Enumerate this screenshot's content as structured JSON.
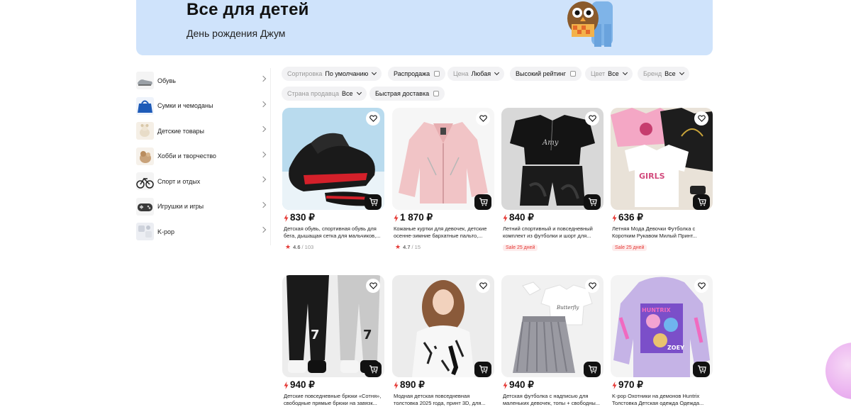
{
  "banner": {
    "title": "Все для детей",
    "subtitle": "День рождения Джум"
  },
  "sidebar": {
    "items": [
      {
        "label": "Обувь",
        "icon": "shoe-thumb"
      },
      {
        "label": "Сумки и чемоданы",
        "icon": "bag-thumb"
      },
      {
        "label": "Детские товары",
        "icon": "toy-thumb"
      },
      {
        "label": "Хобби и творчество",
        "icon": "hobby-thumb"
      },
      {
        "label": "Спорт и отдых",
        "icon": "bike-thumb"
      },
      {
        "label": "Игрушки и игры",
        "icon": "gamepad-thumb"
      },
      {
        "label": "K-pop",
        "icon": "kpop-thumb"
      }
    ]
  },
  "filters": {
    "sort_label": "Сортировка",
    "sort_value": "По умолчанию",
    "sale_label": "Распродажа",
    "price_label": "Цена",
    "price_value": "Любая",
    "rating_label": "Высокий рейтинг",
    "color_label": "Цвет",
    "color_value": "Все",
    "brand_label": "Бренд",
    "brand_value": "Все",
    "country_label": "Страна продавца",
    "country_value": "Все",
    "fast_label": "Быстрая доставка"
  },
  "products": [
    {
      "price": "830 ₽",
      "title": "Детская обувь, спортивная обувь для бега, дышащая сетка для мальчиков,...",
      "rating": "4.6",
      "reviews": "/ 103",
      "sale": ""
    },
    {
      "price": "1 870 ₽",
      "title": "Кожаные куртки для девочек, детские осенне-зимние бархатные пальто,...",
      "rating": "4.7",
      "reviews": "/ 15",
      "sale": ""
    },
    {
      "price": "840 ₽",
      "title": "Летний спортивный и повседневный комплект из футболки и шорт для...",
      "rating": "",
      "reviews": "",
      "sale": "Sale 25 дней"
    },
    {
      "price": "636 ₽",
      "title": "Летняя Мода Девочки Футболка с Коротким Рукавом Милый Принт...",
      "rating": "",
      "reviews": "",
      "sale": "Sale 25 дней"
    },
    {
      "price": "940 ₽",
      "title": "Детские повседневные брюки «Сотня», свободные прямые брюки на завязк...",
      "rating": "",
      "reviews": "",
      "sale": ""
    },
    {
      "price": "890 ₽",
      "title": "Модная детская повседневная толстовка 2025 года, принт 3D, для...",
      "rating": "",
      "reviews": "",
      "sale": ""
    },
    {
      "price": "940 ₽",
      "title": "Детская футболка с надписью для маленьких девочек, топы + свободны...",
      "rating": "",
      "reviews": "",
      "sale": ""
    },
    {
      "price": "970 ₽",
      "title": "K-pop Охотники на демонов Huntrix Толстовка Детская одежда Одежда...",
      "rating": "",
      "reviews": "",
      "sale": ""
    }
  ],
  "colors": {
    "banner_bg": "#cfe3fb",
    "accent_red": "#e53935",
    "chip_bg": "#f2f2f4",
    "cart_bg": "#111111"
  }
}
